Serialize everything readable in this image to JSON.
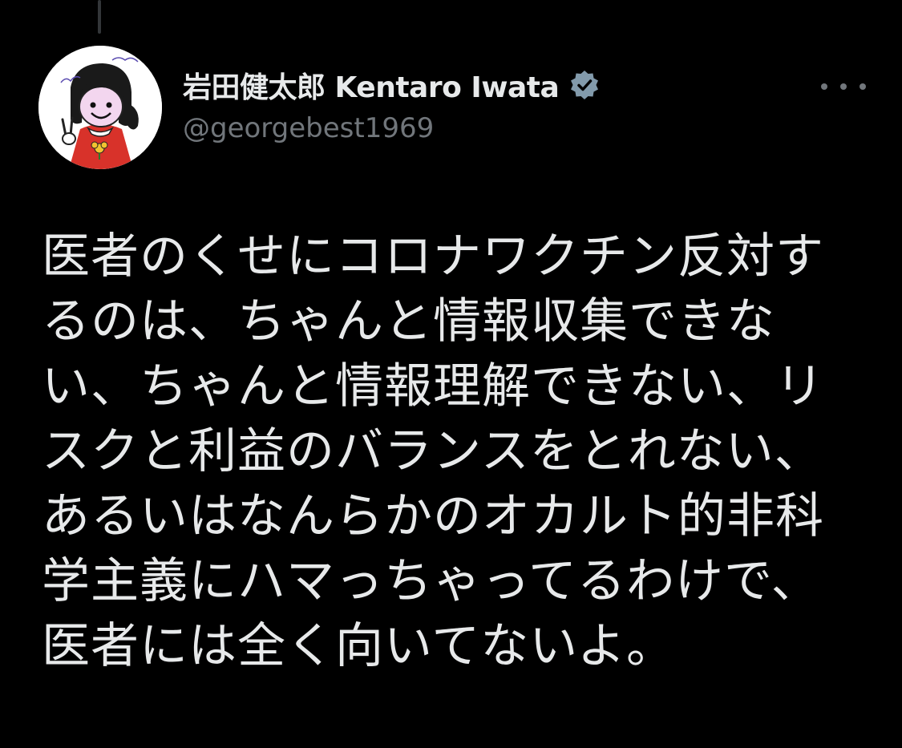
{
  "theme": {
    "background": "#000000",
    "text_primary": "#e7e9ea",
    "text_secondary": "#71767b",
    "verified_badge": "#829aab"
  },
  "author": {
    "display_name": "岩田健太郎 Kentaro Iwata",
    "handle": "@georgebest1969",
    "verified": true,
    "avatar_icon": "cartoon-avatar-icon"
  },
  "actions": {
    "more_icon": "more-horizontal-icon"
  },
  "tweet": {
    "lines": [
      "医者のくせにコロナワクチン反対す",
      "るのは、ちゃんと情報収集できな",
      "い、ちゃんと情報理解できない、リ",
      "スクと利益のバランスをとれない、",
      "あるいはなんらかのオカルト的非科",
      "学主義にハマっちゃってるわけで、",
      "医者には全く向いてないよ。"
    ]
  }
}
